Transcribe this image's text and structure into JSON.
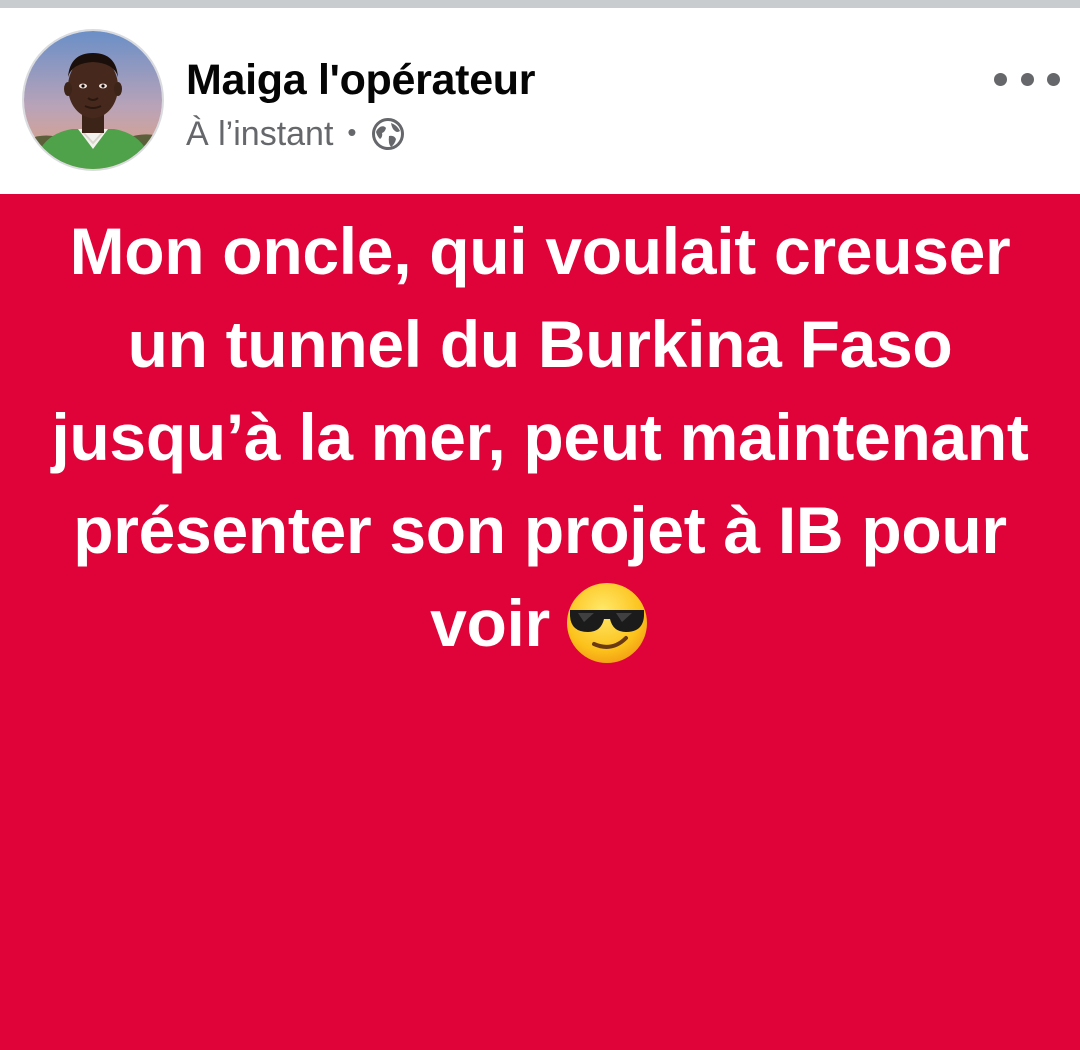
{
  "post": {
    "author_name": "Maiga l'opérateur",
    "timestamp": "À l’instant",
    "separator": "•",
    "privacy_icon": "globe-icon",
    "more_icon": "more-options-icon",
    "background_color": "#e0033a",
    "text_lines": [
      "Mon oncle, qui voulait creuser",
      "un tunnel du Burkina Faso",
      "jusqu’à la mer, peut maintenant",
      "présenter son projet à IB pour",
      "voir"
    ],
    "emoji": "smiling-face-with-sunglasses-icon"
  }
}
